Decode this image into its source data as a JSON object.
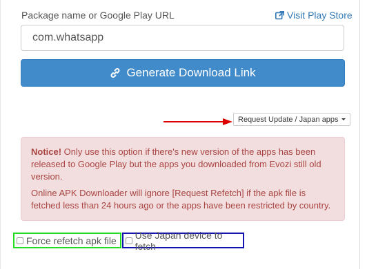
{
  "form": {
    "label": "Package name or Google Play URL",
    "visit_link": "Visit Play Store",
    "input_value": "com.whatsapp",
    "generate_button": "Generate Download Link"
  },
  "dropdown": {
    "label": "Request Update / Japan apps"
  },
  "notice": {
    "title": "Notice!",
    "line1": " Only use this option if there's new version of the apps has been released to Google Play but the apps you downloaded from Evozi still old version.",
    "line2": "Online APK Downloader will ignore [Request Refetch] if the apk file is fetched less than 24 hours ago or the apps have been restricted by country."
  },
  "options": {
    "force_refetch": "Force refetch apk file",
    "japan_device": "Use Japan device to fetch"
  },
  "colors": {
    "primary": "#428bca",
    "alert_bg": "#f2dede",
    "alert_text": "#a94442",
    "highlight_green": "#22dd22",
    "highlight_blue": "#1212b0",
    "arrow": "#dd0000"
  }
}
